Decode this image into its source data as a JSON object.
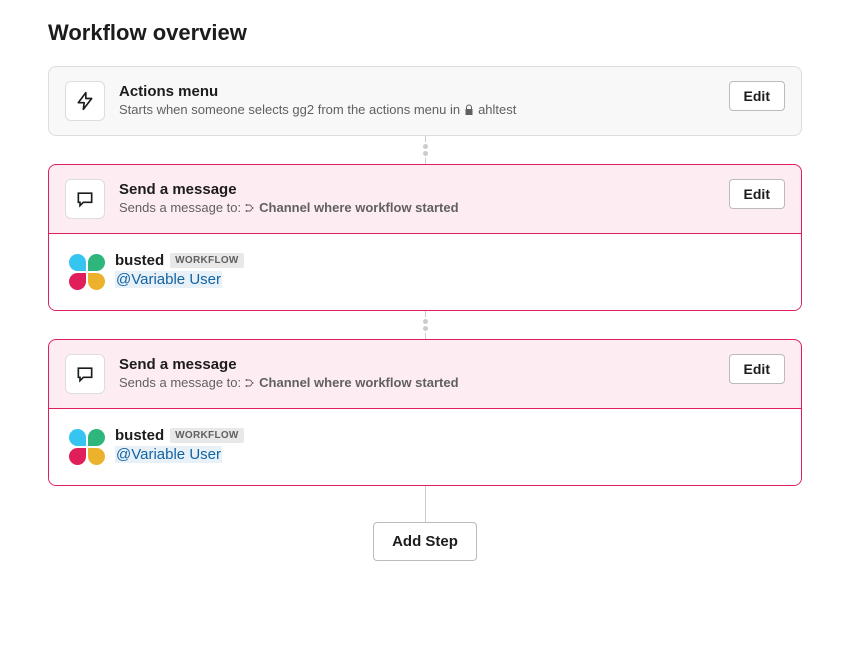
{
  "page_title": "Workflow overview",
  "add_step_label": "Add Step",
  "edit_label": "Edit",
  "trigger": {
    "title": "Actions menu",
    "desc_prefix": "Starts when someone selects gg2 from the actions menu in",
    "channel_name": "ahltest"
  },
  "steps": [
    {
      "title": "Send a message",
      "desc_prefix": "Sends a message to:",
      "destination": "Channel where workflow started",
      "bot_name": "busted",
      "badge": "WORKFLOW",
      "mention": "@Variable User"
    },
    {
      "title": "Send a message",
      "desc_prefix": "Sends a message to:",
      "destination": "Channel where workflow started",
      "bot_name": "busted",
      "badge": "WORKFLOW",
      "mention": "@Variable User"
    }
  ]
}
